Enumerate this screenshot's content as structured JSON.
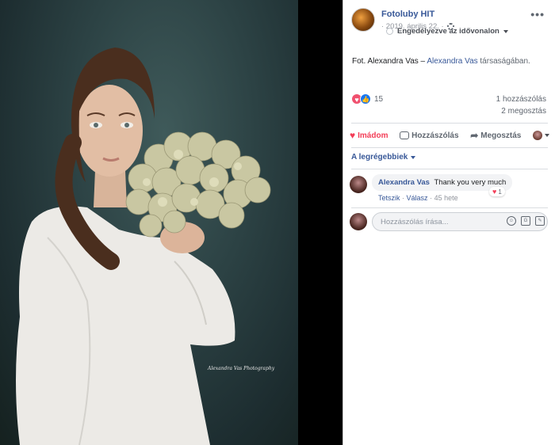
{
  "photo": {
    "watermark": "Alexandra Vas Photography"
  },
  "post": {
    "page_name": "Fotoluby HIT",
    "date": "· 2019. április 22. ·",
    "audience_label": "Engedélyezve az idővonalon",
    "caption": {
      "prefix": "Fot. Alexandra Vas –",
      "tagged_name": "Alexandra Vas",
      "suffix": "társaságában."
    },
    "reactions_count": "15",
    "comments_count": "1 hozzászólás",
    "shares_count": "2 megosztás",
    "more_label": "•••"
  },
  "actions": {
    "love_label": "Imádom",
    "comment_label": "Hozzászólás",
    "share_label": "Megosztás"
  },
  "comments": {
    "sort_label": "A legrégebbiek",
    "items": [
      {
        "author": "Alexandra Vas",
        "text": "Thank you very much",
        "like_label": "Tetszik",
        "reply_label": "Válasz",
        "time": "45 hete",
        "reaction_count": "1"
      }
    ]
  },
  "composer": {
    "placeholder": "Hozzászólás írása..."
  },
  "icons": {
    "reaction_love": "heart-icon",
    "reaction_like": "thumbs-up-icon",
    "gear": "gear-icon",
    "share": "share-arrow-icon",
    "emoji": "smiley-icon",
    "gif": "gif-icon",
    "sticker": "sticker-icon"
  },
  "colors": {
    "link": "#385898",
    "love": "#f33e58",
    "like": "#1877f2"
  }
}
